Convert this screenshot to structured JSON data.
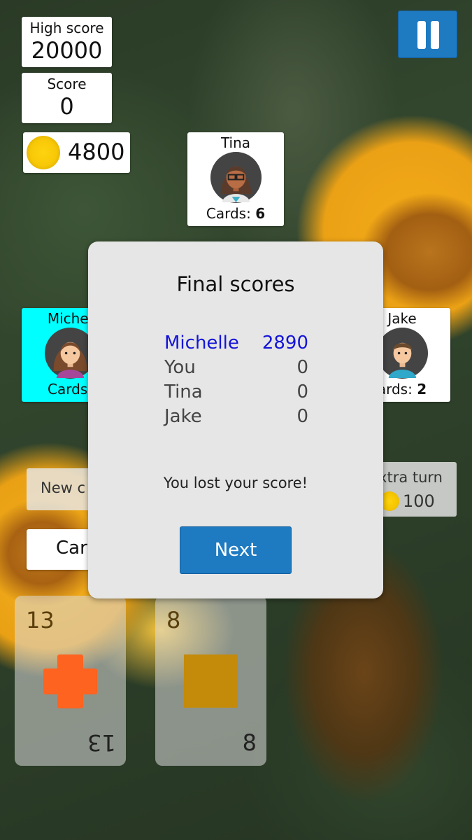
{
  "hud": {
    "high_score_label": "High score",
    "high_score_value": "20000",
    "score_label": "Score",
    "score_value": "0",
    "coins": "4800"
  },
  "players": {
    "tina": {
      "name": "Tina",
      "cards_label": "Cards: ",
      "cards_count": "6"
    },
    "michelle": {
      "name": "Michel",
      "cards_label": "Cards:",
      "cards_count": ""
    },
    "jake": {
      "name": "Jake",
      "cards_label": "ards: ",
      "cards_count": "2"
    }
  },
  "buttons": {
    "new_card": "New c",
    "cards": "Car",
    "extra_turn": "xtra turn",
    "extra_turn_cost": "100"
  },
  "hand": [
    {
      "value": "13",
      "shape": "cross",
      "color": "#ff6320"
    },
    {
      "value": "8",
      "shape": "square",
      "color": "#c48a0a"
    }
  ],
  "dialog": {
    "title": "Final scores",
    "scores": [
      {
        "name": "Michelle",
        "score": "2890"
      },
      {
        "name": "You",
        "score": "0"
      },
      {
        "name": "Tina",
        "score": "0"
      },
      {
        "name": "Jake",
        "score": "0"
      }
    ],
    "message": "You lost your score!",
    "next_label": "Next"
  },
  "colors": {
    "accent": "#1e7ac1",
    "winner_text": "#1515d8",
    "active_player": "#00ffff"
  },
  "icons": {
    "pause": "pause-icon",
    "coin": "coin-icon"
  }
}
